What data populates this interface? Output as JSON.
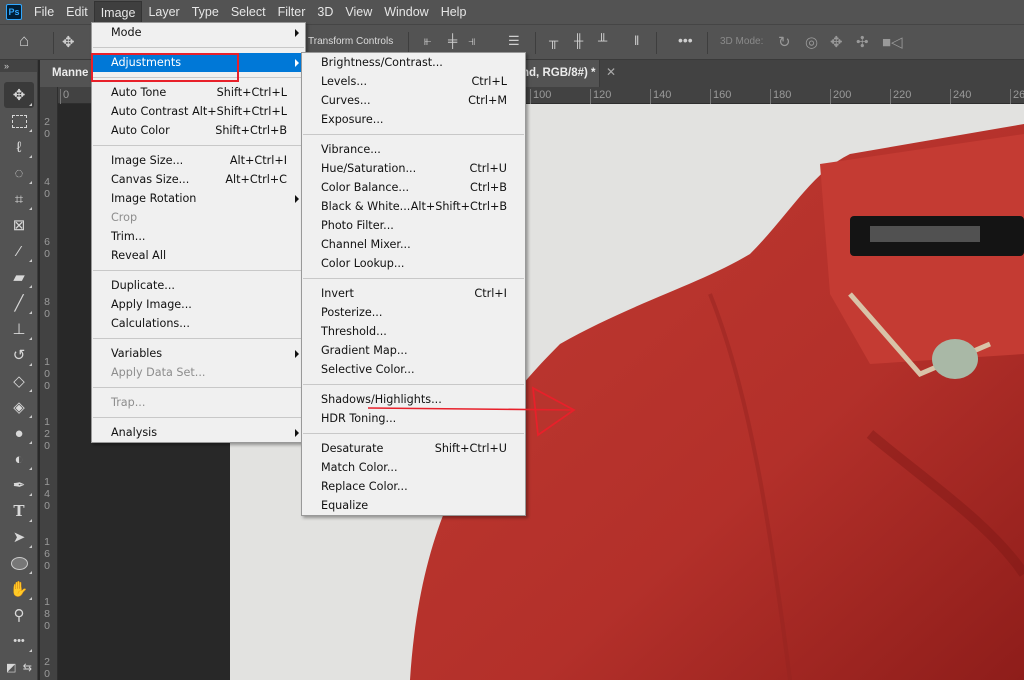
{
  "app": {
    "name": "Adobe Photoshop",
    "logo_text": "Ps"
  },
  "menubar": {
    "items": [
      "File",
      "Edit",
      "Image",
      "Layer",
      "Type",
      "Select",
      "Filter",
      "3D",
      "View",
      "Window",
      "Help"
    ],
    "active": "Image"
  },
  "options_bar": {
    "home_icon": "home-icon",
    "tool_icon": "move-icon",
    "transform_controls_label": "Transform Controls",
    "mode_3d_label": "3D Mode:",
    "more_icon": "ellipsis-icon"
  },
  "document_tab": {
    "title_visible_left": "Manne",
    "title_visible_right": "nd, RGB/8#) *",
    "close_icon": "close-icon"
  },
  "ruler_horizontal": [
    "0",
    "100",
    "120",
    "140",
    "160",
    "180",
    "200",
    "220",
    "240",
    "26"
  ],
  "ruler_vertical": [
    "20",
    "40",
    "60",
    "80",
    "100",
    "120",
    "140",
    "160",
    "180",
    "20"
  ],
  "tools": [
    {
      "name": "move-tool",
      "icon": "move-icon",
      "active": true
    },
    {
      "name": "marquee-tool",
      "icon": "rectangle-marquee-icon"
    },
    {
      "name": "lasso-tool",
      "icon": "lasso-icon"
    },
    {
      "name": "quick-selection-tool",
      "icon": "quick-selection-icon"
    },
    {
      "name": "crop-tool",
      "icon": "crop-icon"
    },
    {
      "name": "frame-tool",
      "icon": "frame-icon"
    },
    {
      "name": "eyedropper-tool",
      "icon": "eyedropper-icon"
    },
    {
      "name": "healing-brush-tool",
      "icon": "bandage-icon"
    },
    {
      "name": "brush-tool",
      "icon": "brush-icon"
    },
    {
      "name": "clone-stamp-tool",
      "icon": "stamp-icon"
    },
    {
      "name": "history-brush-tool",
      "icon": "history-brush-icon"
    },
    {
      "name": "eraser-tool",
      "icon": "eraser-icon"
    },
    {
      "name": "paint-bucket-tool",
      "icon": "paint-bucket-icon"
    },
    {
      "name": "blur-tool",
      "icon": "drop-icon"
    },
    {
      "name": "dodge-tool",
      "icon": "dodge-icon"
    },
    {
      "name": "pen-tool",
      "icon": "pen-icon"
    },
    {
      "name": "type-tool",
      "icon": "type-icon"
    },
    {
      "name": "path-selection-tool",
      "icon": "arrow-cursor-icon"
    },
    {
      "name": "ellipse-tool",
      "icon": "ellipse-icon"
    },
    {
      "name": "hand-tool",
      "icon": "hand-icon"
    },
    {
      "name": "zoom-tool",
      "icon": "zoom-icon"
    },
    {
      "name": "edit-toolbar",
      "icon": "ellipsis-icon"
    }
  ],
  "image_menu": [
    {
      "label": "Mode",
      "submenu": true
    },
    {
      "sep": true
    },
    {
      "label": "Adjustments",
      "submenu": true,
      "highlight": true
    },
    {
      "sep": true
    },
    {
      "label": "Auto Tone",
      "shortcut": "Shift+Ctrl+L"
    },
    {
      "label": "Auto Contrast",
      "shortcut": "Alt+Shift+Ctrl+L"
    },
    {
      "label": "Auto Color",
      "shortcut": "Shift+Ctrl+B"
    },
    {
      "sep": true
    },
    {
      "label": "Image Size...",
      "shortcut": "Alt+Ctrl+I"
    },
    {
      "label": "Canvas Size...",
      "shortcut": "Alt+Ctrl+C"
    },
    {
      "label": "Image Rotation",
      "submenu": true
    },
    {
      "label": "Crop",
      "disabled": true
    },
    {
      "label": "Trim..."
    },
    {
      "label": "Reveal All"
    },
    {
      "sep": true
    },
    {
      "label": "Duplicate..."
    },
    {
      "label": "Apply Image..."
    },
    {
      "label": "Calculations..."
    },
    {
      "sep": true
    },
    {
      "label": "Variables",
      "submenu": true
    },
    {
      "label": "Apply Data Set...",
      "disabled": true
    },
    {
      "sep": true
    },
    {
      "label": "Trap...",
      "disabled": true
    },
    {
      "sep": true
    },
    {
      "label": "Analysis",
      "submenu": true
    }
  ],
  "adjustments_menu": [
    {
      "label": "Brightness/Contrast..."
    },
    {
      "label": "Levels...",
      "shortcut": "Ctrl+L"
    },
    {
      "label": "Curves...",
      "shortcut": "Ctrl+M"
    },
    {
      "label": "Exposure..."
    },
    {
      "sep": true
    },
    {
      "label": "Vibrance..."
    },
    {
      "label": "Hue/Saturation...",
      "shortcut": "Ctrl+U"
    },
    {
      "label": "Color Balance...",
      "shortcut": "Ctrl+B"
    },
    {
      "label": "Black & White...",
      "shortcut": "Alt+Shift+Ctrl+B"
    },
    {
      "label": "Photo Filter..."
    },
    {
      "label": "Channel Mixer..."
    },
    {
      "label": "Color Lookup..."
    },
    {
      "sep": true
    },
    {
      "label": "Invert",
      "shortcut": "Ctrl+I"
    },
    {
      "label": "Posterize..."
    },
    {
      "label": "Threshold..."
    },
    {
      "label": "Gradient Map..."
    },
    {
      "label": "Selective Color..."
    },
    {
      "sep": true
    },
    {
      "label": "Shadows/Highlights...",
      "annotated": true
    },
    {
      "label": "HDR Toning..."
    },
    {
      "sep": true
    },
    {
      "label": "Desaturate",
      "shortcut": "Shift+Ctrl+U"
    },
    {
      "label": "Match Color..."
    },
    {
      "label": "Replace Color..."
    },
    {
      "label": "Equalize"
    }
  ],
  "annotation": {
    "color": "#e8202a",
    "highlight_target": "Adjustments",
    "arrow_target": "Shadows/Highlights..."
  },
  "colors": {
    "menu_highlight": "#0078d7",
    "jacket_red": "#b8352e",
    "background": "#e2e2e0"
  }
}
